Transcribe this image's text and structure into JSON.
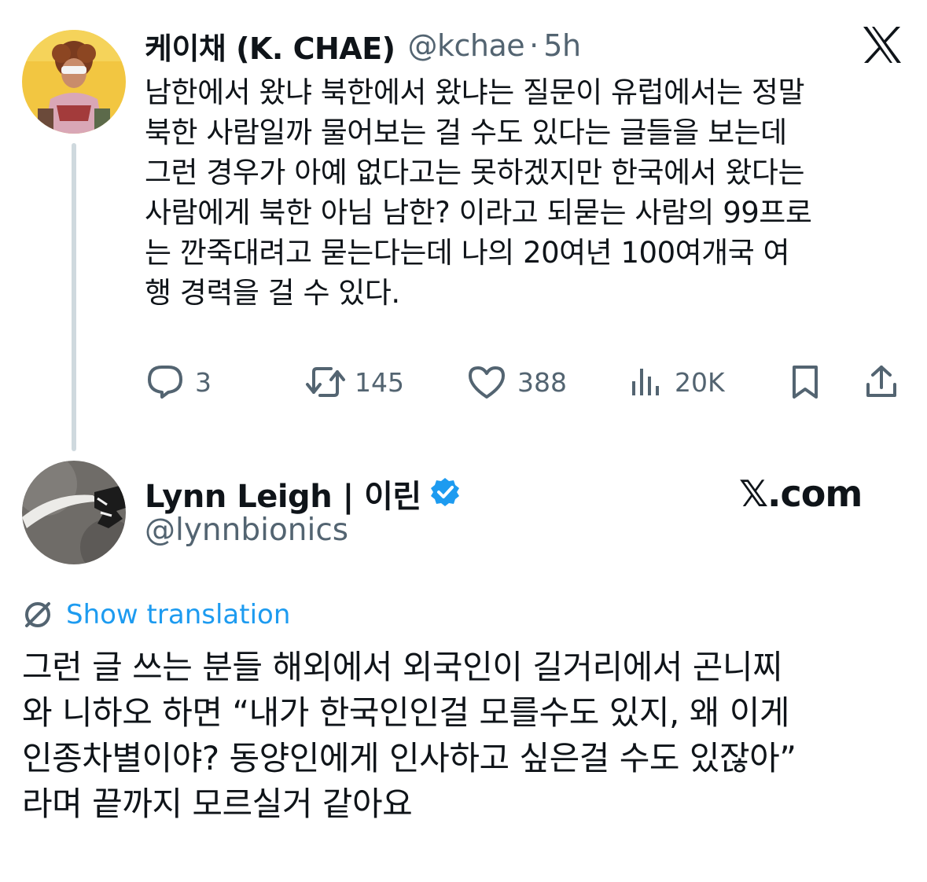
{
  "tweet": {
    "display_name": "케이채 (K. CHAE)",
    "handle": "@kchae",
    "separator": "·",
    "time": "5h",
    "lines": [
      "남한에서 왔냐 북한에서 왔냐는 질문이 유럽에서는 정말",
      "북한 사람일까 물어보는 걸 수도 있다는 글들을 보는데",
      "그런 경우가 아예 없다고는 못하겠지만 한국에서 왔다는",
      "사람에게 북한 아님 남한? 이라고 되묻는 사람의 99프로",
      "는 깐죽대려고 묻는다는데 나의 20여년 100여개국 여",
      "행 경력을 걸 수 있다."
    ],
    "actions": {
      "replies": "3",
      "reposts": "145",
      "likes": "388",
      "views": "20K"
    }
  },
  "reply": {
    "display_name": "Lynn Leigh | 이린",
    "handle": "@lynnbionics",
    "verified_color": "#1d9bf0",
    "brand_text": "𝕏.com",
    "show_translation": "Show translation",
    "lines": [
      "그런 글 쓰는 분들 해외에서 외국인이 길거리에서 곤니찌",
      "와 니하오 하면 “내가 한국인인걸 모를수도 있지, 왜 이게",
      "인종차별이야? 동양인에게 인사하고 싶은걸 수도 있잖아”",
      "라며 끝까지 모르실거 같아요"
    ]
  },
  "colors": {
    "text": "#0f1419",
    "secondary": "#536471",
    "accent": "#1d9bf0",
    "thread_line": "#cfd9de"
  },
  "icons": [
    "x-logo-icon",
    "reply-icon",
    "repost-icon",
    "like-icon",
    "views-icon",
    "bookmark-icon",
    "share-icon",
    "verified-badge-icon",
    "translate-icon"
  ]
}
